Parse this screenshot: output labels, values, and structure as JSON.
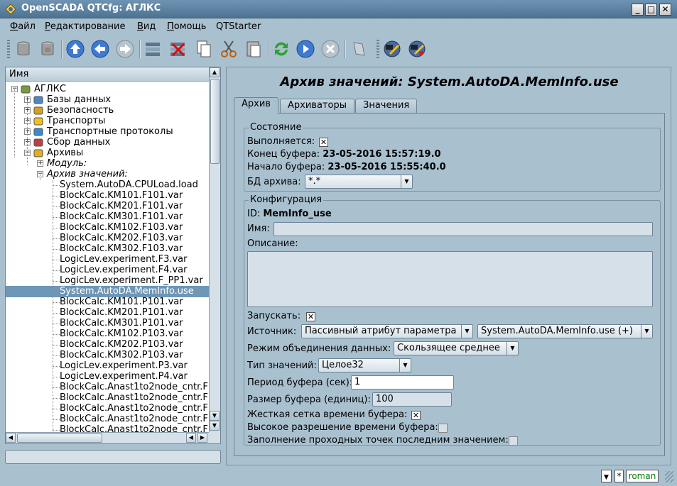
{
  "window": {
    "title": "OpenSCADA QTCfg: АГЛКС"
  },
  "menu": [
    {
      "label": "Файл",
      "u": "Ф",
      "rest": "айл"
    },
    {
      "label": "Редактирование",
      "u": "Р",
      "rest": "едактирование"
    },
    {
      "label": "Вид",
      "u": "В",
      "rest": "ид"
    },
    {
      "label": "Помощь",
      "u": "П",
      "rest": "омощь"
    },
    {
      "label": "QTStarter",
      "u": "",
      "rest": "QTStarter"
    }
  ],
  "toolbar_icons": [
    "db-load-icon",
    "db-save-icon",
    "up-icon",
    "back-icon",
    "forward-icon",
    "add-item-icon",
    "delete-item-icon",
    "copy-icon",
    "cut-icon",
    "paste-icon",
    "refresh-icon",
    "start-icon",
    "stop-icon",
    "item-icon",
    "qtcfg-icon",
    "uicfg-icon"
  ],
  "tree": {
    "header": "Имя",
    "nodes": [
      {
        "label": "АГЛКС",
        "level": 0,
        "exp": "-"
      },
      {
        "label": "Базы данных",
        "level": 1,
        "exp": "+"
      },
      {
        "label": "Безопасность",
        "level": 1,
        "exp": "+"
      },
      {
        "label": "Транспорты",
        "level": 1,
        "exp": "+"
      },
      {
        "label": "Транспортные протоколы",
        "level": 1,
        "exp": "+"
      },
      {
        "label": "Сбор данных",
        "level": 1,
        "exp": "+"
      },
      {
        "label": "Архивы",
        "level": 1,
        "exp": "-"
      },
      {
        "label": "Модуль:",
        "level": 2,
        "exp": "+"
      },
      {
        "label": "Архив значений:",
        "level": 2,
        "exp": "-"
      },
      {
        "label": "System.AutoDA.CPULoad.load",
        "level": 3
      },
      {
        "label": "BlockCalc.KM101.F101.var",
        "level": 3
      },
      {
        "label": "BlockCalc.KM201.F101.var",
        "level": 3
      },
      {
        "label": "BlockCalc.KM301.F101.var",
        "level": 3
      },
      {
        "label": "BlockCalc.KM102.F103.var",
        "level": 3
      },
      {
        "label": "BlockCalc.KM202.F103.var",
        "level": 3
      },
      {
        "label": "BlockCalc.KM302.F103.var",
        "level": 3
      },
      {
        "label": "LogicLev.experiment.F3.var",
        "level": 3
      },
      {
        "label": "LogicLev.experiment.F4.var",
        "level": 3
      },
      {
        "label": "LogicLev.experiment.F_PP1.var",
        "level": 3
      },
      {
        "label": "System.AutoDA.MemInfo.use",
        "level": 3,
        "selected": true
      },
      {
        "label": "BlockCalc.KM101.P101.var",
        "level": 3
      },
      {
        "label": "BlockCalc.KM201.P101.var",
        "level": 3
      },
      {
        "label": "BlockCalc.KM301.P101.var",
        "level": 3
      },
      {
        "label": "BlockCalc.KM102.P103.var",
        "level": 3
      },
      {
        "label": "BlockCalc.KM202.P103.var",
        "level": 3
      },
      {
        "label": "BlockCalc.KM302.P103.var",
        "level": 3
      },
      {
        "label": "LogicLev.experiment.P3.var",
        "level": 3
      },
      {
        "label": "LogicLev.experiment.P4.var",
        "level": 3
      },
      {
        "label": "BlockCalc.Anast1to2node_cntr.F",
        "level": 3
      },
      {
        "label": "BlockCalc.Anast1to2node_cntr.F",
        "level": 3
      },
      {
        "label": "BlockCalc.Anast1to2node_cntr.F",
        "level": 3
      },
      {
        "label": "BlockCalc.Anast1to2node_cntr.F",
        "level": 3
      },
      {
        "label": "BlockCalc.Anast1to2node_cntr.F",
        "level": 3
      }
    ]
  },
  "page": {
    "title": "Архив значений: System.AutoDA.MemInfo.use",
    "tabs": [
      "Архив",
      "Архиваторы",
      "Значения"
    ],
    "state": {
      "group": "Состояние",
      "running_label": "Выполняется:",
      "running": true,
      "buf_end_label": "Конец буфера:",
      "buf_end": "23-05-2016 15:57:19.0",
      "buf_start_label": "Начало буфера:",
      "buf_start": "23-05-2016 15:55:40.0",
      "db_label": "БД архива:",
      "db_value": "*.*"
    },
    "config": {
      "group": "Конфигурация",
      "id_label": "ID:",
      "id_value": "MemInfo_use",
      "name_label": "Имя:",
      "name_value": "",
      "descr_label": "Описание:",
      "descr_value": "",
      "start_label": "Запускать:",
      "start": true,
      "source_label": "Источник:",
      "source_type": "Пассивный атрибут параметра",
      "source_value": "System.AutoDA.MemInfo.use (+)",
      "combine_label": "Режим объединения данных:",
      "combine_value": "Скользящее среднее",
      "type_label": "Тип значений:",
      "type_value": "Целое32",
      "period_label": "Период буфера (сек):",
      "period_value": "1",
      "size_label": "Размер буфера (единиц):",
      "size_value": "100",
      "hard_grid_label": "Жесткая сетка времени буфера:",
      "hard_grid": true,
      "high_res_label": "Высокое разрешение времени буфера:",
      "high_res": false,
      "fill_label": "Заполнение проходных точек последним значением:",
      "fill": false
    }
  },
  "status": {
    "star": "*",
    "user": "roman"
  }
}
